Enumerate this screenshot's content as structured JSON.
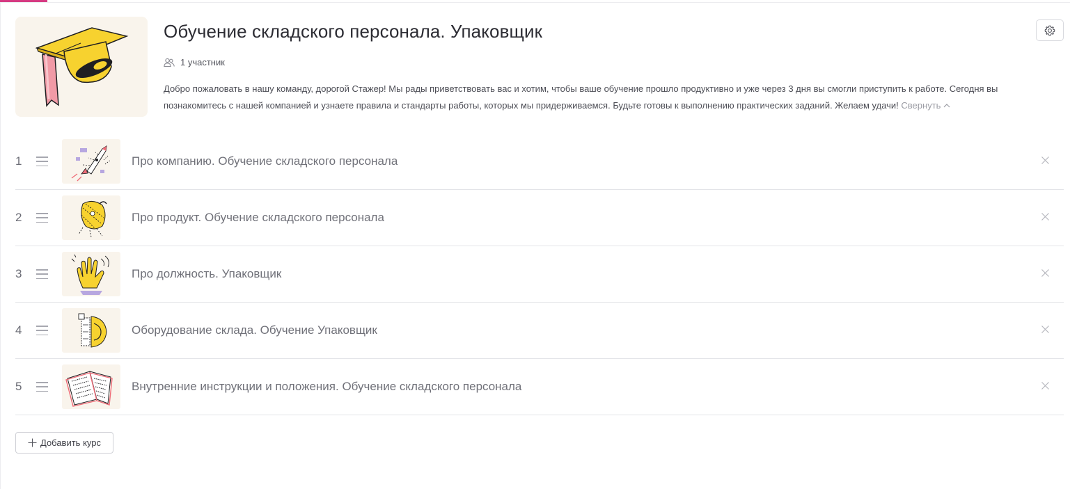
{
  "program": {
    "title": "Обучение складского персонала. Упаковщик",
    "members": "1 участник",
    "description": "Добро пожаловать в нашу команду, дорогой Стажер! Мы рады приветствовать вас и хотим, чтобы ваше обучение прошло продуктивно и уже через 3 дня вы смогли приступить к работе. Сегодня вы познакомитесь с нашей компанией и узнаете правила и стандарты работы, которых мы придерживаемся. Будьте готовы к выполнению практических заданий. Желаем удачи!",
    "collapse_label": "Свернуть",
    "cover_icon": "graduation-cap-icon",
    "settings_icon": "gear-icon"
  },
  "courses": [
    {
      "number": "1",
      "title": "Про компанию. Обучение складского персонала",
      "icon": "rocket-illustration"
    },
    {
      "number": "2",
      "title": "Про продукт. Обучение складского персонала",
      "icon": "product-illustration"
    },
    {
      "number": "3",
      "title": "Про должность. Упаковщик",
      "icon": "hand-illustration"
    },
    {
      "number": "4",
      "title": "Оборудование склада. Обучение Упаковщик",
      "icon": "equipment-illustration"
    },
    {
      "number": "5",
      "title": "Внутренние инструкции и положения. Обучение складского персонала",
      "icon": "book-illustration"
    }
  ],
  "actions": {
    "add_course": "Добавить курс"
  },
  "colors": {
    "accent": "#d63a82",
    "thumb_bg": "#f9f4ec",
    "yellow": "#f7d22f",
    "pink": "#f19aa6"
  }
}
